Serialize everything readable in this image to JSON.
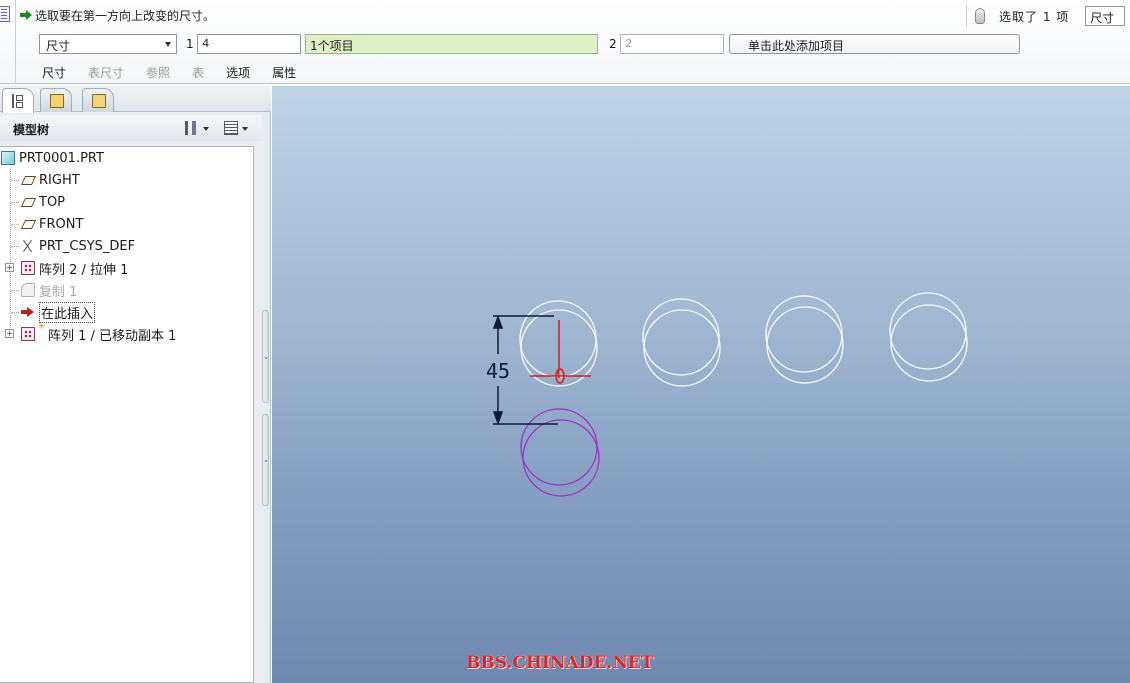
{
  "dashboard": {
    "prompt": "选取要在第一方向上改变的尺寸。",
    "selection_status": "选取了 1 项",
    "filter_value": "尺寸",
    "pattern_type": "尺寸",
    "dir1_label": "1",
    "dir1_count": "4",
    "dir1_collector": "1个项目",
    "dir2_label": "2",
    "dir2_count": "2",
    "dir2_collector": "单击此处添加项目",
    "tabs": [
      {
        "label": "尺寸",
        "enabled": true
      },
      {
        "label": "表尺寸",
        "enabled": false
      },
      {
        "label": "参照",
        "enabled": false
      },
      {
        "label": "表",
        "enabled": false
      },
      {
        "label": "选项",
        "enabled": true
      },
      {
        "label": "属性",
        "enabled": true
      }
    ]
  },
  "navigator": {
    "tab_icons": [
      "model-tree-icon",
      "layers-icon",
      "favorites-folder-icon"
    ],
    "title": "模型树",
    "items": [
      {
        "label": "PRT0001.PRT",
        "icon": "part-icon"
      },
      {
        "label": "RIGHT",
        "icon": "datum-plane-icon"
      },
      {
        "label": "TOP",
        "icon": "datum-plane-icon"
      },
      {
        "label": "FRONT",
        "icon": "datum-plane-icon"
      },
      {
        "label": "PRT_CSYS_DEF",
        "icon": "csys-icon"
      },
      {
        "label": "阵列 2 / 拉伸 1",
        "icon": "pattern-icon"
      },
      {
        "label": "复制 1",
        "icon": "copy-icon"
      },
      {
        "label": "在此插入",
        "icon": "insert-arrow-icon"
      },
      {
        "label": "阵列 1 / 已移动副本 1",
        "icon": "pattern-icon"
      }
    ]
  },
  "graphics": {
    "dimension_value": "45",
    "watermark": "BBS.CHINADE.NET",
    "colors": {
      "geometry": "#ffffff",
      "highlight": "#9a2fc8",
      "dimension": "#101a3a",
      "csys": "#d42020"
    }
  }
}
